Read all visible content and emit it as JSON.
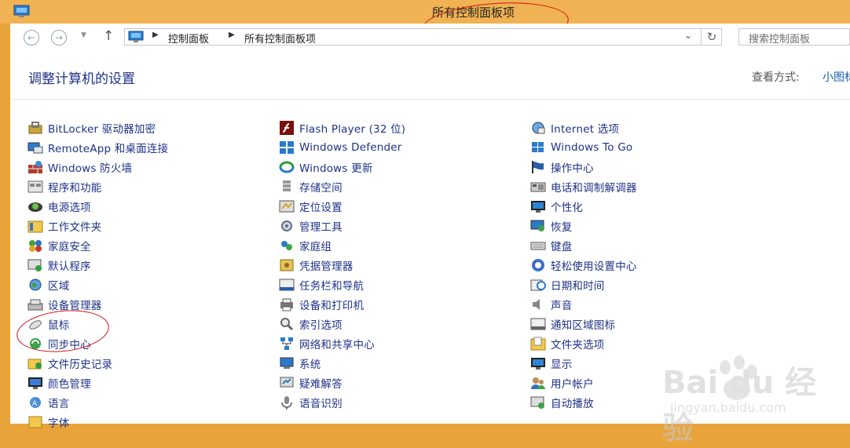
{
  "window": {
    "title": "所有控制面板项"
  },
  "nav": {
    "back_icon": "back-arrow-icon",
    "forward_icon": "forward-arrow-icon",
    "up_icon": "up-arrow-icon"
  },
  "address": {
    "crumbs": [
      "控制面板",
      "所有控制面板项"
    ]
  },
  "search": {
    "placeholder": "搜索控制面板"
  },
  "page": {
    "heading": "调整计算机的设置"
  },
  "view": {
    "label": "查看方式:",
    "value": "小图标"
  },
  "columns": [
    [
      {
        "label": "BitLocker 驱动器加密",
        "icon": "bitlocker-icon"
      },
      {
        "label": "RemoteApp 和桌面连接",
        "icon": "remoteapp-icon"
      },
      {
        "label": "Windows 防火墙",
        "icon": "firewall-icon"
      },
      {
        "label": "程序和功能",
        "icon": "programs-icon"
      },
      {
        "label": "电源选项",
        "icon": "power-icon"
      },
      {
        "label": "工作文件夹",
        "icon": "work-folders-icon"
      },
      {
        "label": "家庭安全",
        "icon": "family-safety-icon"
      },
      {
        "label": "默认程序",
        "icon": "default-programs-icon"
      },
      {
        "label": "区域",
        "icon": "region-icon"
      },
      {
        "label": "设备管理器",
        "icon": "device-manager-icon"
      },
      {
        "label": "鼠标",
        "icon": "mouse-icon"
      },
      {
        "label": "同步中心",
        "icon": "sync-center-icon"
      },
      {
        "label": "文件历史记录",
        "icon": "file-history-icon"
      },
      {
        "label": "颜色管理",
        "icon": "color-management-icon"
      },
      {
        "label": "语言",
        "icon": "language-icon"
      },
      {
        "label": "字体",
        "icon": "fonts-icon"
      }
    ],
    [
      {
        "label": "Flash Player (32 位)",
        "icon": "flash-icon"
      },
      {
        "label": "Windows Defender",
        "icon": "defender-icon"
      },
      {
        "label": "Windows 更新",
        "icon": "windows-update-icon"
      },
      {
        "label": "存储空间",
        "icon": "storage-spaces-icon"
      },
      {
        "label": "定位设置",
        "icon": "location-icon"
      },
      {
        "label": "管理工具",
        "icon": "admin-tools-icon"
      },
      {
        "label": "家庭组",
        "icon": "homegroup-icon"
      },
      {
        "label": "凭据管理器",
        "icon": "credential-manager-icon"
      },
      {
        "label": "任务栏和导航",
        "icon": "taskbar-icon"
      },
      {
        "label": "设备和打印机",
        "icon": "devices-printers-icon"
      },
      {
        "label": "索引选项",
        "icon": "indexing-icon"
      },
      {
        "label": "网络和共享中心",
        "icon": "network-icon"
      },
      {
        "label": "系统",
        "icon": "system-icon"
      },
      {
        "label": "疑难解答",
        "icon": "troubleshooting-icon"
      },
      {
        "label": "语音识别",
        "icon": "speech-icon"
      }
    ],
    [
      {
        "label": "Internet 选项",
        "icon": "internet-options-icon"
      },
      {
        "label": "Windows To Go",
        "icon": "windows-to-go-icon"
      },
      {
        "label": "操作中心",
        "icon": "action-center-icon"
      },
      {
        "label": "电话和调制解调器",
        "icon": "phone-modem-icon"
      },
      {
        "label": "个性化",
        "icon": "personalization-icon"
      },
      {
        "label": "恢复",
        "icon": "recovery-icon"
      },
      {
        "label": "键盘",
        "icon": "keyboard-icon"
      },
      {
        "label": "轻松使用设置中心",
        "icon": "ease-of-access-icon"
      },
      {
        "label": "日期和时间",
        "icon": "date-time-icon"
      },
      {
        "label": "声音",
        "icon": "sound-icon"
      },
      {
        "label": "通知区域图标",
        "icon": "notification-icons-icon"
      },
      {
        "label": "文件夹选项",
        "icon": "folder-options-icon"
      },
      {
        "label": "显示",
        "icon": "display-icon"
      },
      {
        "label": "用户帐户",
        "icon": "user-accounts-icon"
      },
      {
        "label": "自动播放",
        "icon": "autoplay-icon"
      }
    ]
  ],
  "watermark": {
    "brand": "Bai du 经验",
    "url": "jingyan.baidu.com"
  },
  "colors": {
    "titlebar": "#f0b252",
    "link": "#1e3287",
    "annotation": "#d0121b"
  }
}
